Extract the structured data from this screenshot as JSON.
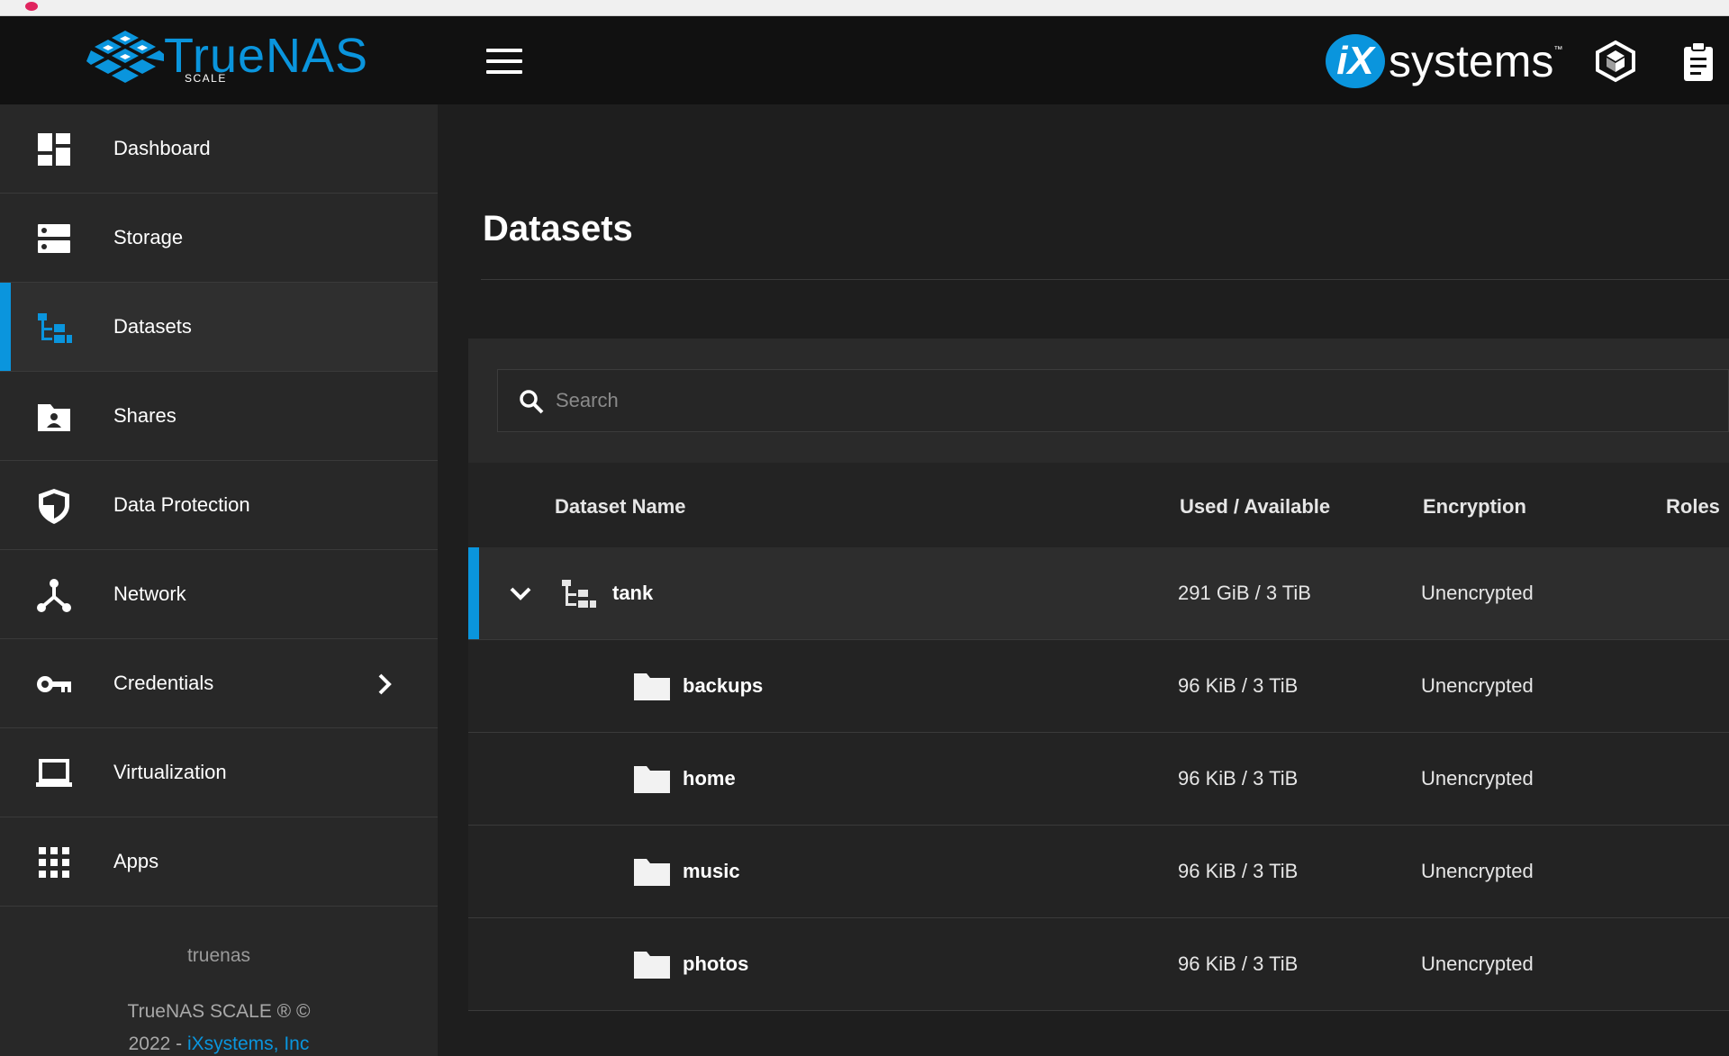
{
  "app": {
    "brand_name": "TrueNAS",
    "brand_edition": "SCALE",
    "vendor_prefix": "iX",
    "vendor_name": "systems",
    "vendor_tm": "™"
  },
  "sidebar": {
    "items": [
      {
        "label": "Dashboard",
        "icon": "dashboard-icon"
      },
      {
        "label": "Storage",
        "icon": "storage-icon"
      },
      {
        "label": "Datasets",
        "icon": "datasets-icon",
        "active": true
      },
      {
        "label": "Shares",
        "icon": "shares-icon"
      },
      {
        "label": "Data Protection",
        "icon": "shield-icon"
      },
      {
        "label": "Network",
        "icon": "network-icon"
      },
      {
        "label": "Credentials",
        "icon": "key-icon",
        "has_submenu": true
      },
      {
        "label": "Virtualization",
        "icon": "laptop-icon"
      },
      {
        "label": "Apps",
        "icon": "apps-grid-icon"
      }
    ],
    "hostname": "truenas",
    "copyright_line1": "TrueNAS SCALE ® ©",
    "copyright_year": "2022 - ",
    "copyright_company": "iXsystems, Inc"
  },
  "main": {
    "title": "Datasets",
    "search": {
      "placeholder": "Search",
      "value": ""
    },
    "table": {
      "columns": [
        "Dataset Name",
        "Used / Available",
        "Encryption",
        "Roles"
      ],
      "rows": [
        {
          "name": "tank",
          "used": "291 GiB / 3 TiB",
          "encryption": "Unencrypted",
          "type": "pool",
          "expanded": true
        },
        {
          "name": "backups",
          "used": "96 KiB / 3 TiB",
          "encryption": "Unencrypted",
          "type": "folder"
        },
        {
          "name": "home",
          "used": "96 KiB / 3 TiB",
          "encryption": "Unencrypted",
          "type": "folder"
        },
        {
          "name": "music",
          "used": "96 KiB / 3 TiB",
          "encryption": "Unencrypted",
          "type": "folder"
        },
        {
          "name": "photos",
          "used": "96 KiB / 3 TiB",
          "encryption": "Unencrypted",
          "type": "folder"
        }
      ]
    }
  },
  "colors": {
    "accent": "#0a95dd",
    "topbar": "#111111",
    "sidebar": "#282828",
    "background": "#1e1e1e"
  }
}
